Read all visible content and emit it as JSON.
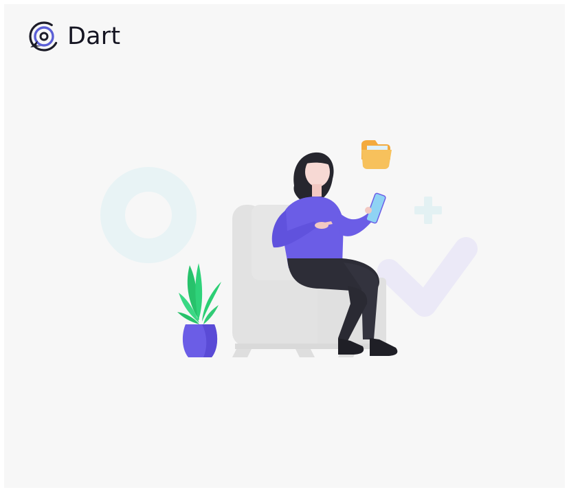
{
  "brand": {
    "name": "Dart",
    "logo_icon": "dart-target-icon",
    "logo_color": "#5b5fd6"
  },
  "colors": {
    "background": "#f7f7f7",
    "accent_purple": "#6c5ce7",
    "plant_green": "#2fcf77",
    "folder_yellow": "#f6bc56",
    "chair_gray": "#e0e0e0"
  }
}
